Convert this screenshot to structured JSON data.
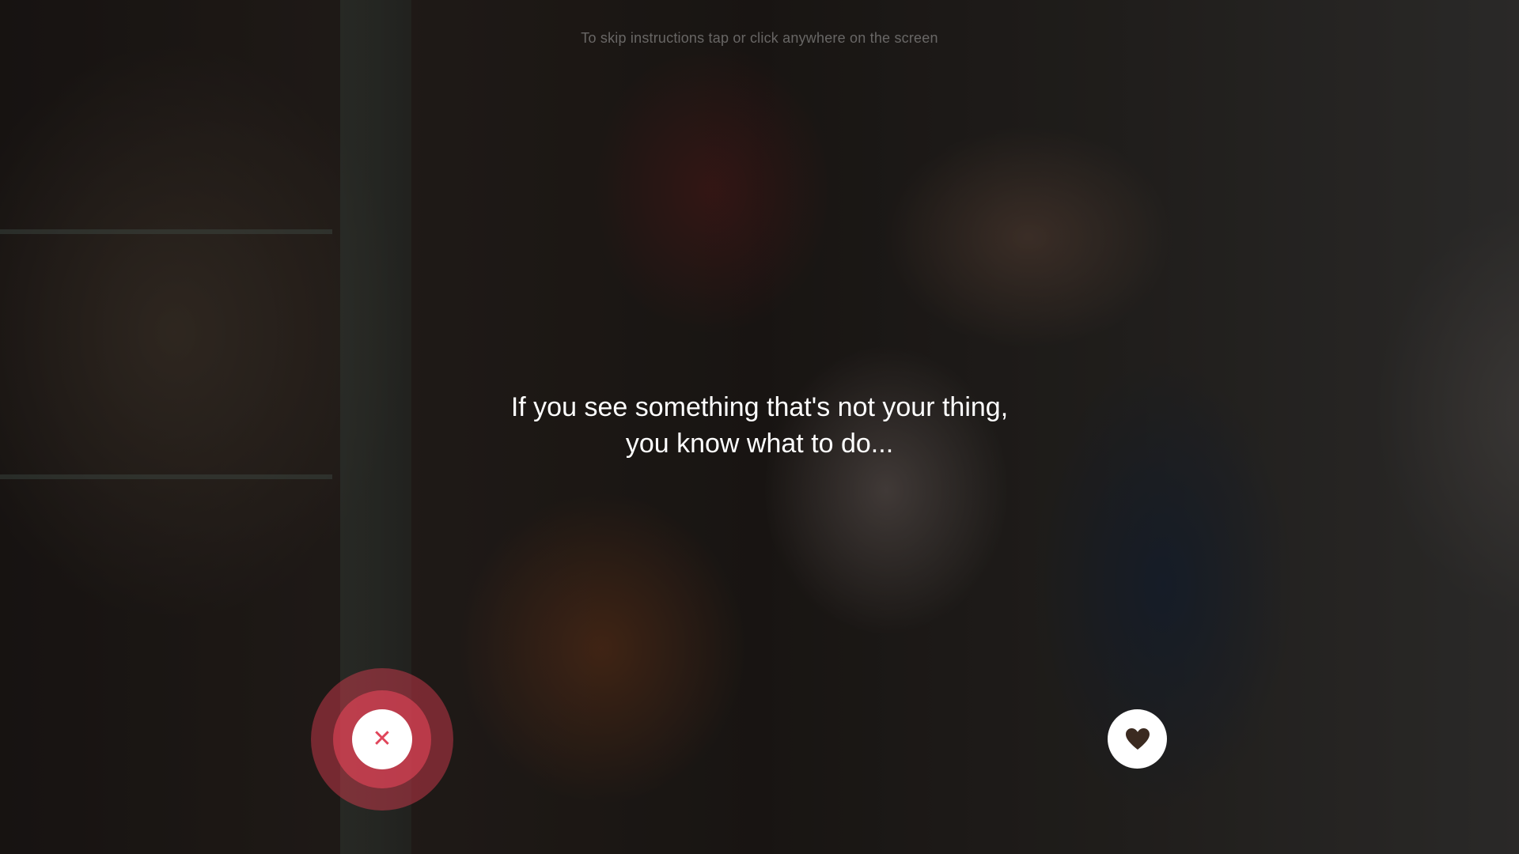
{
  "onboarding": {
    "skip_hint": "To skip instructions tap or click anywhere on the screen",
    "instruction_line1": "If you see something that's not your thing,",
    "instruction_line2": "you know what to do..."
  },
  "actions": {
    "reject_icon": "close-icon",
    "reject_glyph": "✕",
    "like_icon": "heart-icon"
  },
  "colors": {
    "reject_accent": "#e0455a",
    "like_icon": "#3b2a20",
    "overlay": "rgba(0,0,0,0.45)"
  }
}
